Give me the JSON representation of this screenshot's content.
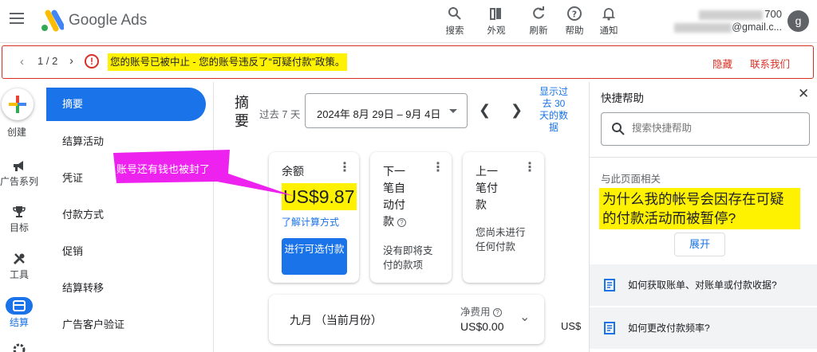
{
  "header": {
    "app_title": "Google Ads",
    "account_id_suffix": "700",
    "account_email_suffix": "@gmail.c...",
    "avatar_letter": "g",
    "tools": [
      {
        "label": "搜索",
        "icon": "search-icon"
      },
      {
        "label": "外观",
        "icon": "appearance-icon"
      },
      {
        "label": "刷新",
        "icon": "refresh-icon"
      },
      {
        "label": "帮助",
        "icon": "help-icon"
      },
      {
        "label": "通知",
        "icon": "bell-icon"
      }
    ]
  },
  "alert": {
    "page_count": "1 / 2",
    "message": "您的账号已被中止 - 您的账号违反了“可疑付款”政策。",
    "hide_label": "隐藏",
    "contact_label": "联系我们"
  },
  "rail": {
    "create_label": "创建",
    "items": [
      {
        "label": "广告系列",
        "icon": "megaphone-icon"
      },
      {
        "label": "目标",
        "icon": "trophy-icon"
      },
      {
        "label": "工具",
        "icon": "tools-icon"
      },
      {
        "label": "结算",
        "icon": "billing-icon"
      }
    ]
  },
  "subnav": {
    "items": [
      "摘要",
      "结算活动",
      "凭证",
      "付款方式",
      "促销",
      "结算转移",
      "广告客户验证"
    ]
  },
  "main": {
    "title": "摘要",
    "range_label": "过去 7 天",
    "date_range": "2024年 8月 29日 – 9月 4日",
    "show_data": "显示过去 30 天的数据",
    "balance": {
      "title": "余额",
      "amount": "US$9.87",
      "learn_link": "了解计算方式",
      "pay_button": "进行可选付款"
    },
    "next_card": {
      "title": "下一笔自动付款",
      "note": "没有即将支付的款项"
    },
    "last_card": {
      "title": "上一笔付款",
      "note": "您尚未进行任何付款"
    },
    "month": {
      "title": "九月 （当前月份）",
      "net_label": "净费用",
      "net_value": "US$0.00",
      "clipped_value": "US$"
    }
  },
  "annotation": {
    "text": "账号还有钱也被封了",
    "color": "#ee22ee"
  },
  "help": {
    "title": "快捷帮助",
    "search_placeholder": "搜索快捷帮助",
    "related_label": "与此页面相关",
    "question": "为什么我的帐号会因存在可疑的付款活动而被暂停?",
    "expand_label": "展开",
    "links": [
      "如何获取账单、对账单或付款收据?",
      "如何更改付款频率?"
    ]
  },
  "colors": {
    "brand_blue": "#1a73e8",
    "error_red": "#d93025",
    "highlight_yellow": "#fff200"
  }
}
